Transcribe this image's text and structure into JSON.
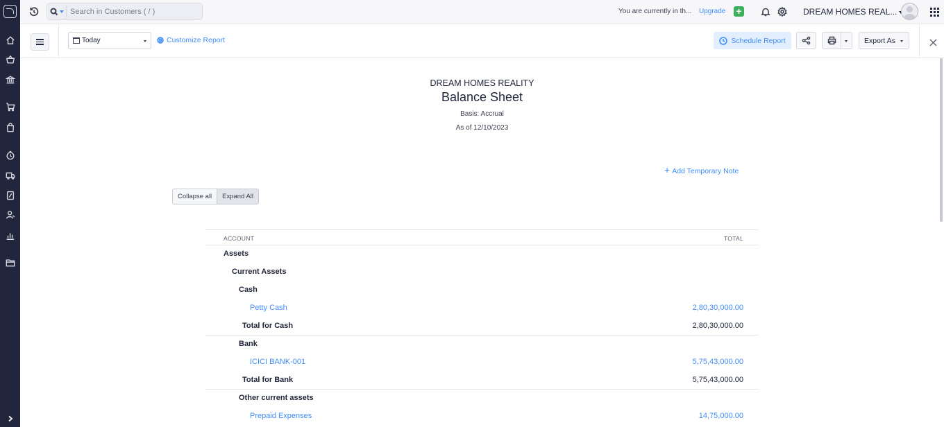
{
  "topbar": {
    "search_placeholder": "Search in Customers ( / )",
    "trial_text": "You are currently in th...",
    "upgrade_label": "Upgrade",
    "plus_label": "+",
    "org_name": "DREAM HOMES REAL..."
  },
  "toolbar": {
    "date_filter": "Today",
    "customize_label": "Customize Report",
    "schedule_label": "Schedule Report",
    "export_label": "Export As"
  },
  "report": {
    "org": "DREAM HOMES REALITY",
    "title": "Balance Sheet",
    "basis": "Basis: Accrual",
    "as_of": "As of 12/10/2023",
    "add_note": "Add Temporary Note",
    "collapse_all": "Collapse all",
    "expand_all": "Expand All",
    "columns": {
      "account": "ACCOUNT",
      "total": "TOTAL"
    },
    "rows": {
      "assets": "Assets",
      "current_assets": "Current Assets",
      "cash": "Cash",
      "petty_cash": {
        "label": "Petty Cash",
        "value": "2,80,30,000.00"
      },
      "total_cash": {
        "label": "Total for Cash",
        "value": "2,80,30,000.00"
      },
      "bank": "Bank",
      "icici": {
        "label": "ICICI BANK-001",
        "value": "5,75,43,000.00"
      },
      "total_bank": {
        "label": "Total for Bank",
        "value": "5,75,43,000.00"
      },
      "other_current": "Other current assets",
      "prepaid": {
        "label": "Prepaid Expenses",
        "value": "14,75,000.00"
      }
    }
  }
}
